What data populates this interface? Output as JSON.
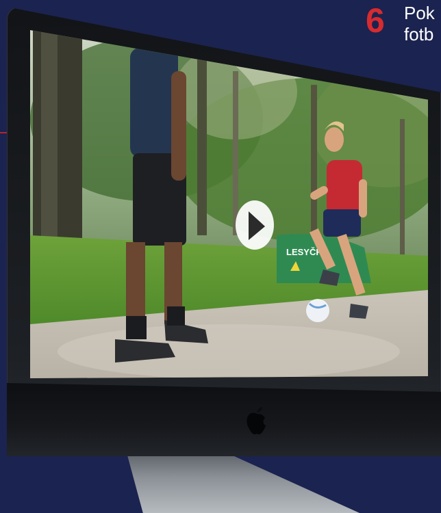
{
  "step": {
    "number": "6",
    "text_line1": "Pok",
    "text_line2": "fotb"
  },
  "banner": {
    "brand": "LESYČR"
  },
  "video": {
    "state": "paused",
    "play_icon": "play-icon"
  },
  "colors": {
    "background": "#1b2350",
    "accent_red": "#d62b2f",
    "monitor_bezel": "#15171b",
    "grass": "#5f9a2e"
  }
}
